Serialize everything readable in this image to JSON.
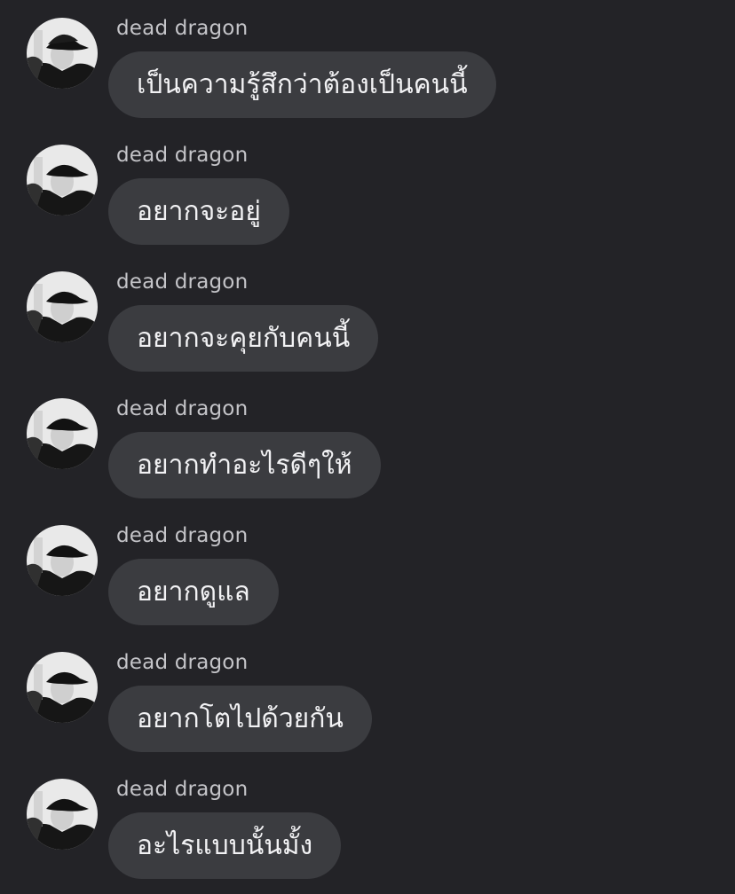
{
  "sender_name": "dead dragon",
  "messages": [
    {
      "text": "เป็นความรู้สึกว่าต้องเป็นคนนี้"
    },
    {
      "text": "อยากจะอยู่"
    },
    {
      "text": "อยากจะคุยกับคนนี้"
    },
    {
      "text": "อยากทำอะไรดีๆให้"
    },
    {
      "text": "อยากดูแล"
    },
    {
      "text": "อยากโตไปด้วยกัน"
    },
    {
      "text": "อะไรแบบนั้นมั้ง"
    }
  ]
}
